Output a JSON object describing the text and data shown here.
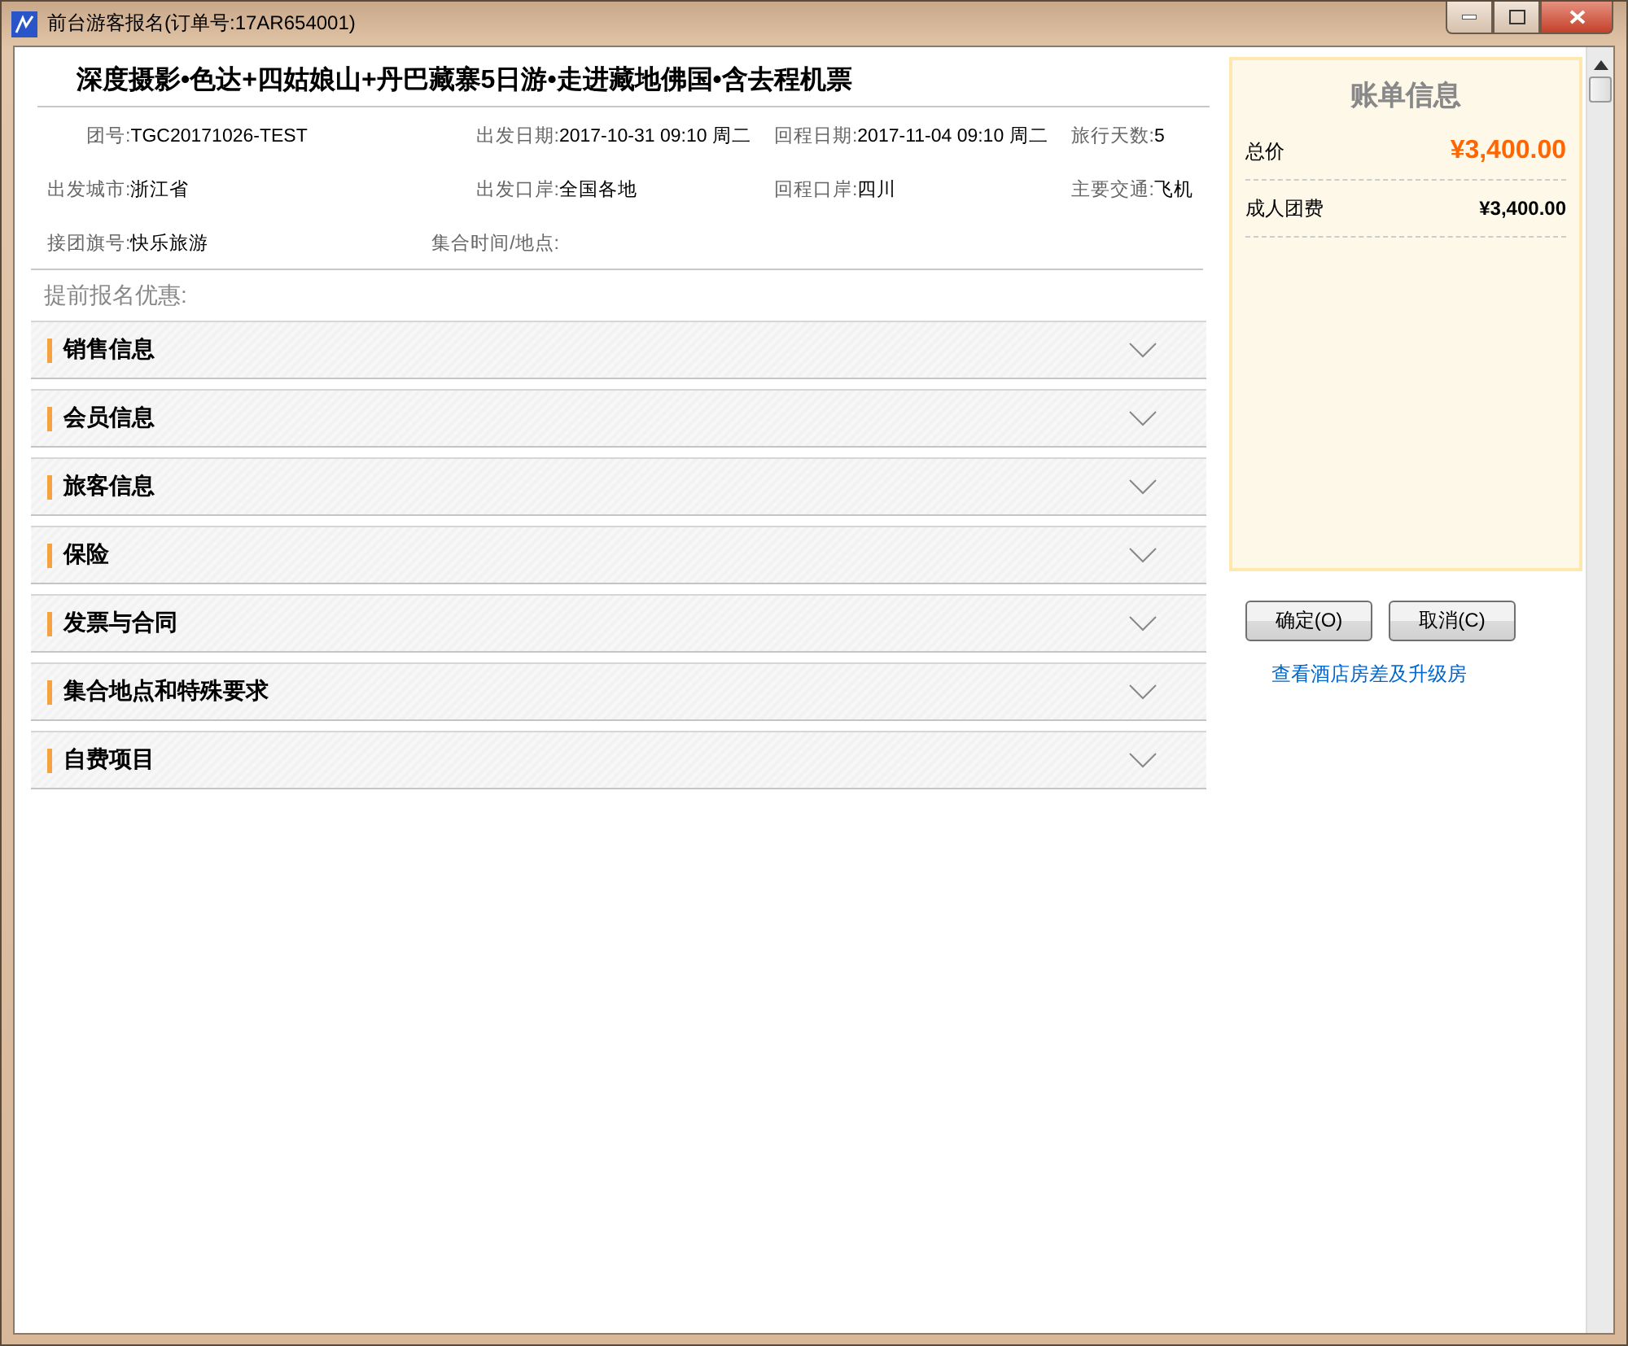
{
  "window": {
    "title": "前台游客报名(订单号:17AR654001)"
  },
  "tour": {
    "title": "深度摄影•色达+四姑娘山+丹巴藏寨5日游•走进藏地佛国•含去程机票",
    "fields": [
      {
        "label": "团号:",
        "value": "TGC20171026-TEST"
      },
      {
        "label": "出发日期:",
        "value": "2017-10-31 09:10 周二"
      },
      {
        "label": "回程日期:",
        "value": "2017-11-04 09:10 周二"
      },
      {
        "label": "旅行天数:",
        "value": "5"
      },
      {
        "label": "出发城市:",
        "value": "浙江省"
      },
      {
        "label": "出发口岸:",
        "value": "全国各地"
      },
      {
        "label": "回程口岸:",
        "value": "四川"
      },
      {
        "label": "主要交通:",
        "value": "飞机"
      },
      {
        "label": "接团旗号:",
        "value": "快乐旅游"
      },
      {
        "label": "集合时间/地点:"
      }
    ],
    "discount_label": "提前报名优惠:"
  },
  "sections": [
    {
      "title": "销售信息",
      "expanded": false
    },
    {
      "title": "会员信息",
      "expanded": false
    },
    {
      "title": "旅客信息",
      "expanded": false
    },
    {
      "title": "保险",
      "expanded": false
    },
    {
      "title": "发票与合同",
      "expanded": false
    },
    {
      "title": "集合地点和特殊要求",
      "expanded": false
    },
    {
      "title": "自费项目",
      "expanded": false
    }
  ],
  "bill": {
    "title": "账单信息",
    "total_label": "总价",
    "total": "¥3,400.00",
    "items": [
      {
        "label": "成人团费",
        "amount": "¥3,400.00"
      }
    ]
  },
  "buttons": [
    {
      "label": "确定(O)"
    },
    {
      "label": "取消(C)"
    }
  ],
  "link": "查看酒店房差及升级房"
}
